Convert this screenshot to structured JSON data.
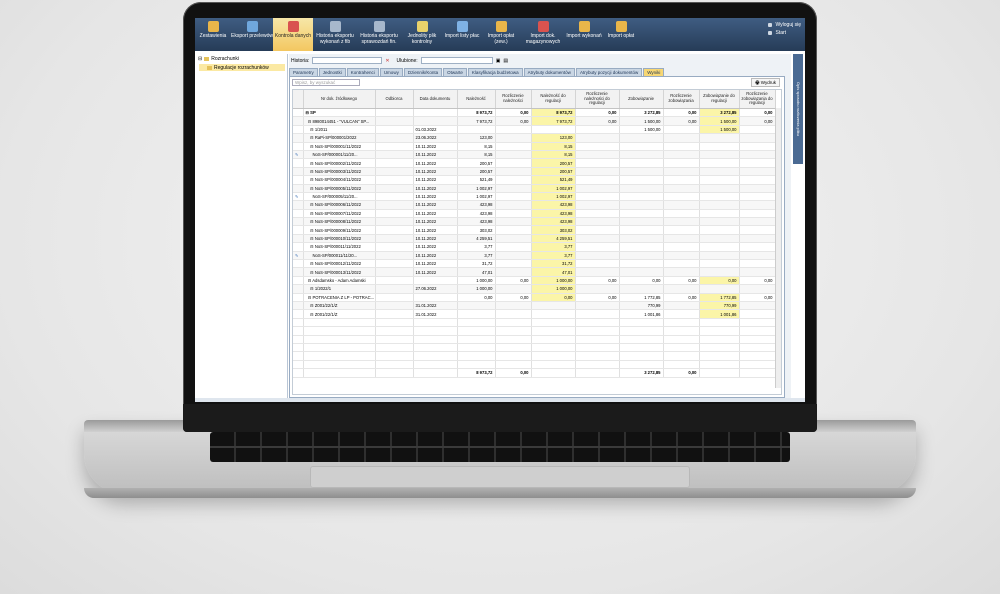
{
  "toolbar": {
    "items": [
      {
        "label": "Zestawienia",
        "color": "#e9b64a"
      },
      {
        "label": "Eksport przelewów",
        "color": "#6fa7dd"
      },
      {
        "label": "Kontrola danych",
        "color": "#d9534f"
      },
      {
        "label": "Historia eksportu wykonań z fib",
        "color": "#a7b8cc"
      },
      {
        "label": "Historia eksportu sprawozdań fin.",
        "color": "#a7b8cc"
      },
      {
        "label": "Jednolity plik kontrolny",
        "color": "#e9d26b"
      },
      {
        "label": "Import listy płac",
        "color": "#7fb2e5"
      },
      {
        "label": "Import opłat (zew.)",
        "color": "#e9b64a"
      },
      {
        "label": "Import dok. magazynowych",
        "color": "#d9534f"
      },
      {
        "label": "Import wykonań",
        "color": "#e9b64a"
      },
      {
        "label": "Import opłat",
        "color": "#e9b64a"
      }
    ],
    "right": [
      "Wyloguj się",
      "Start"
    ]
  },
  "tree": {
    "root": "Rozrachunki",
    "child": "Regulacje rozrachunków"
  },
  "filters": {
    "historia": "Historia:",
    "ulubione": "Ulubione:"
  },
  "tabs": [
    "Parametry",
    "Jednostki",
    "Kontrahenci",
    "Umowy",
    "Dziennik/Konta",
    "Otwarte",
    "Klasyfikacja budżetowa",
    "Atrybuty dokumentów",
    "Atrybuty pozycji dokumentów",
    "Wyniki"
  ],
  "search_placeholder": "Wpisz, by wyszukać",
  "print_label": "Wydruk",
  "side_panel": "Opis sposobu rozliczenia pliku",
  "columns": [
    "",
    "Nr dok. źródłowego",
    "Odbiorca",
    "Data dokumentu",
    "Należność",
    "Rozliczenie należności",
    "Należność do regulacji",
    "Rozliczenie należności do regulacji",
    "Zobowiązanie",
    "Rozliczenie zobowiązania",
    "Zobowiązanie do regulacji",
    "Rozliczenie zobowiązania do regulacji"
  ],
  "rows": [
    {
      "b": true,
      "c": [
        "",
        "⊟ SP",
        "",
        "",
        "8 973,72",
        "0,00",
        "8 973,72",
        "0,00",
        "3 272,85",
        "0,00",
        "3 272,85",
        "0,00"
      ]
    },
    {
      "b": false,
      "c": [
        "",
        "  ⊟ 8980014451 - \"VULCAN\" SP...",
        "",
        "",
        "7 973,72",
        "0,00",
        "7 973,72",
        "0,00",
        "1 500,00",
        "0,00",
        "1 500,00",
        "0,00"
      ]
    },
    {
      "b": false,
      "c": [
        "",
        "    ⊟ 1/2011",
        "",
        "01.03.2022",
        "",
        "",
        "",
        "",
        "1 500,00",
        "",
        "1 500,00",
        ""
      ]
    },
    {
      "b": false,
      "c": [
        "",
        "    ⊟ RaPi-SP/000001/2022",
        "",
        "23.06.2022",
        "123,00",
        "",
        "123,00",
        "",
        "",
        "",
        "",
        ""
      ]
    },
    {
      "b": false,
      "c": [
        "",
        "    ⊟ NoS-SP/000001/11/2022",
        "",
        "10.11.2022",
        "8,15",
        "",
        "8,15",
        "",
        "",
        "",
        "",
        ""
      ]
    },
    {
      "b": false,
      "c": [
        "pin",
        "      NoS-SP/000001/11/20...",
        "",
        "10.11.2022",
        "8,15",
        "",
        "8,15",
        "",
        "",
        "",
        "",
        ""
      ]
    },
    {
      "b": false,
      "c": [
        "",
        "    ⊟ NoS-SP/000002/11/2022",
        "",
        "10.11.2022",
        "200,57",
        "",
        "200,57",
        "",
        "",
        "",
        "",
        ""
      ]
    },
    {
      "b": false,
      "c": [
        "",
        "    ⊟ NoS-SP/000003/11/2022",
        "",
        "10.11.2022",
        "200,57",
        "",
        "200,57",
        "",
        "",
        "",
        "",
        ""
      ]
    },
    {
      "b": false,
      "c": [
        "",
        "    ⊟ NoS-SP/000004/11/2022",
        "",
        "10.11.2022",
        "521,49",
        "",
        "521,49",
        "",
        "",
        "",
        "",
        ""
      ]
    },
    {
      "b": false,
      "c": [
        "",
        "    ⊟ NoS-SP/000005/11/2022",
        "",
        "10.11.2022",
        "1 002,97",
        "",
        "1 002,97",
        "",
        "",
        "",
        "",
        ""
      ]
    },
    {
      "b": false,
      "c": [
        "pin",
        "      NoS-SP/000005/11/20...",
        "",
        "10.11.2022",
        "1 002,97",
        "",
        "1 002,97",
        "",
        "",
        "",
        "",
        ""
      ]
    },
    {
      "b": false,
      "c": [
        "",
        "    ⊟ NoS-SP/000006/11/2022",
        "",
        "10.11.2022",
        "423,98",
        "",
        "423,98",
        "",
        "",
        "",
        "",
        ""
      ]
    },
    {
      "b": false,
      "c": [
        "",
        "    ⊟ NoS-SP/000007/11/2022",
        "",
        "10.11.2022",
        "423,98",
        "",
        "423,98",
        "",
        "",
        "",
        "",
        ""
      ]
    },
    {
      "b": false,
      "c": [
        "",
        "    ⊟ NoS-SP/000008/11/2022",
        "",
        "10.11.2022",
        "423,98",
        "",
        "423,98",
        "",
        "",
        "",
        "",
        ""
      ]
    },
    {
      "b": false,
      "c": [
        "",
        "    ⊟ NoS-SP/000009/11/2022",
        "",
        "10.11.2022",
        "303,02",
        "",
        "303,02",
        "",
        "",
        "",
        "",
        ""
      ]
    },
    {
      "b": false,
      "c": [
        "",
        "    ⊟ NoS-SP/000010/11/2022",
        "",
        "10.11.2022",
        "4 259,51",
        "",
        "4 259,51",
        "",
        "",
        "",
        "",
        ""
      ]
    },
    {
      "b": false,
      "c": [
        "",
        "    ⊟ NoS-SP/000011/11/2022",
        "",
        "10.11.2022",
        "3,77",
        "",
        "3,77",
        "",
        "",
        "",
        "",
        ""
      ]
    },
    {
      "b": false,
      "c": [
        "pin",
        "      NoS-SP/000011/11/20...",
        "",
        "10.11.2022",
        "3,77",
        "",
        "3,77",
        "",
        "",
        "",
        "",
        ""
      ]
    },
    {
      "b": false,
      "c": [
        "",
        "    ⊟ NoS-SP/000012/11/2022",
        "",
        "10.11.2022",
        "31,72",
        "",
        "31,72",
        "",
        "",
        "",
        "",
        ""
      ]
    },
    {
      "b": false,
      "c": [
        "",
        "    ⊟ NoS-SP/000013/11/2022",
        "",
        "10.11.2022",
        "47,01",
        "",
        "47,01",
        "",
        "",
        "",
        "",
        ""
      ]
    },
    {
      "b": false,
      "c": [
        "",
        "  ⊟ Adsdamsko - Adam Adamski",
        "",
        "",
        "1 000,00",
        "0,00",
        "1 000,00",
        "0,00",
        "0,00",
        "0,00",
        "0,00",
        "0,00"
      ]
    },
    {
      "b": false,
      "c": [
        "",
        "    ⊟ 1/2022/1",
        "",
        "27.06.2022",
        "1 000,00",
        "",
        "1 000,00",
        "",
        "",
        "",
        "",
        ""
      ]
    },
    {
      "b": false,
      "c": [
        "",
        "  ⊟ POTRACENIA Z LP - POTRAC...",
        "",
        "",
        "0,00",
        "0,00",
        "0,00",
        "0,00",
        "1 772,85",
        "0,00",
        "1 772,85",
        "0,00"
      ]
    },
    {
      "b": false,
      "c": [
        "",
        "    ⊟ Z001/22/1/Z",
        "",
        "31.01.2022",
        "",
        "",
        "",
        "",
        "770,99",
        "",
        "770,99",
        ""
      ]
    },
    {
      "b": false,
      "c": [
        "",
        "    ⊟ Z001/22/1/Z",
        "",
        "31.01.2022",
        "",
        "",
        "",
        "",
        "1 001,86",
        "",
        "1 001,86",
        ""
      ]
    }
  ],
  "totals": [
    "",
    "",
    "",
    "",
    "8 973,72",
    "0,00",
    "",
    "",
    "3 272,85",
    "0,00",
    "",
    ""
  ]
}
